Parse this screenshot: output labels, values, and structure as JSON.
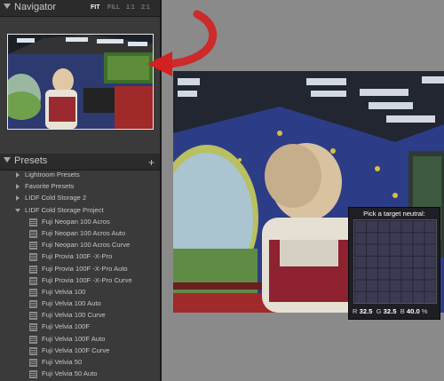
{
  "navigator": {
    "title": "Navigator",
    "zoom_options": [
      "FIT",
      "FILL",
      "1:1",
      "2:1"
    ],
    "active_zoom": "FIT"
  },
  "presets": {
    "title": "Presets",
    "add_label": "+",
    "items": [
      {
        "label": "Lightroom Presets",
        "kind": "folder",
        "expanded": false
      },
      {
        "label": "Favorite Presets",
        "kind": "folder",
        "expanded": false
      },
      {
        "label": "LIDF Cold Storage 2",
        "kind": "folder",
        "expanded": false
      },
      {
        "label": "LIDF Cold Storage Project",
        "kind": "folder",
        "expanded": true
      },
      {
        "label": "Fuji Neopan 100 Acros",
        "kind": "preset"
      },
      {
        "label": "Fuji Neopan 100 Acros Auto",
        "kind": "preset"
      },
      {
        "label": "Fuji Neopan 100 Acros Curve",
        "kind": "preset"
      },
      {
        "label": "Fuji Provia 100F -X-Pro",
        "kind": "preset"
      },
      {
        "label": "Fuji Provia 100F -X-Pro Auto",
        "kind": "preset"
      },
      {
        "label": "Fuji Provia 100F -X-Pro Curve",
        "kind": "preset"
      },
      {
        "label": "Fuji Velvia 100",
        "kind": "preset"
      },
      {
        "label": "Fuji Velvia 100 Auto",
        "kind": "preset"
      },
      {
        "label": "Fuji Velvia 100 Curve",
        "kind": "preset"
      },
      {
        "label": "Fuji Velvia 100F",
        "kind": "preset"
      },
      {
        "label": "Fuji Velvia 100F Auto",
        "kind": "preset"
      },
      {
        "label": "Fuji Velvia 100F Curve",
        "kind": "preset"
      },
      {
        "label": "Fuji Velvia 50",
        "kind": "preset"
      },
      {
        "label": "Fuji Velvia 50 Auto",
        "kind": "preset"
      }
    ]
  },
  "loupe": {
    "title": "Pick a target neutral:",
    "r_label": "R",
    "r_value": "32.5",
    "g_label": "G",
    "g_value": "32.5",
    "b_label": "B",
    "b_value": "40.0",
    "unit": "%"
  },
  "colors": {
    "panel_bg": "#3a3a3a",
    "header_bg": "#2b2b2b",
    "workspace_bg": "#8a8a8a",
    "arrow_red": "#d42020"
  },
  "icons": {
    "collapse_triangle": "triangle-down-icon",
    "folder_closed": "triangle-right-icon",
    "preset": "preset-icon",
    "arrow": "curved-arrow-icon"
  }
}
